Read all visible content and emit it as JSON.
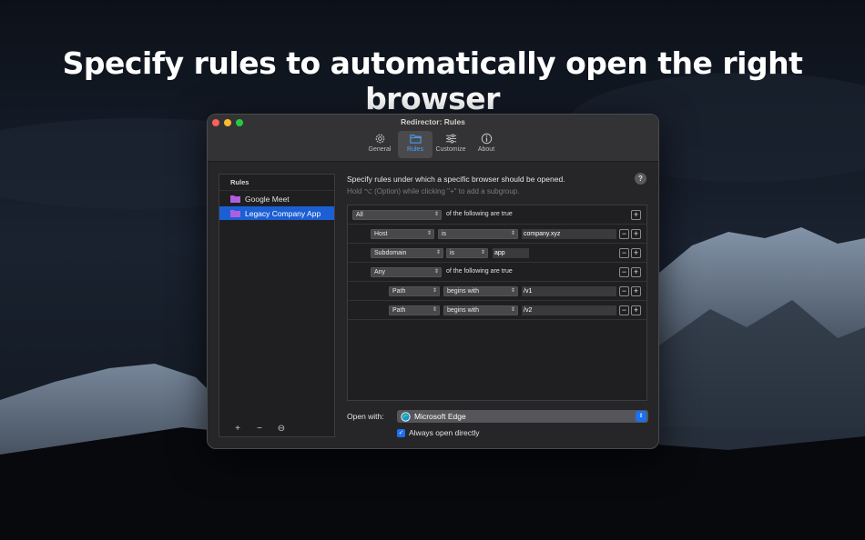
{
  "headline": "Specify rules to automatically open the right browser",
  "window": {
    "title": "Redirector: Rules"
  },
  "toolbar": {
    "tabs": [
      {
        "label": "General",
        "icon": "gear-icon",
        "selected": false
      },
      {
        "label": "Rules",
        "icon": "folder-icon",
        "selected": true
      },
      {
        "label": "Customize",
        "icon": "sliders-icon",
        "selected": false
      },
      {
        "label": "About",
        "icon": "info-icon",
        "selected": false
      }
    ]
  },
  "sidebar": {
    "header": "Rules",
    "items": [
      {
        "label": "Google Meet",
        "selected": false
      },
      {
        "label": "Legacy Company App",
        "selected": true
      }
    ],
    "footer": {
      "add": "+",
      "remove": "−",
      "more": "⊖"
    }
  },
  "main": {
    "description": "Specify rules under which a specific browser should be opened.",
    "hint": "Hold ⌥ (Option) while clicking \"+\" to add a subgroup.",
    "help": "?",
    "rules": [
      {
        "type": "group",
        "quantifier": "All",
        "suffix": "of the following are true"
      },
      {
        "type": "condition",
        "field": "Host",
        "operator": "is",
        "value": "company.xyz"
      },
      {
        "type": "condition",
        "field": "Subdomain",
        "operator": "is",
        "value": "app"
      },
      {
        "type": "group",
        "quantifier": "Any",
        "suffix": "of the following are true"
      },
      {
        "type": "condition",
        "field": "Path",
        "operator": "begins with",
        "value": "/v1"
      },
      {
        "type": "condition",
        "field": "Path",
        "operator": "begins with",
        "value": "/v2"
      }
    ],
    "open_with_label": "Open with:",
    "browser": "Microsoft Edge",
    "always_open_label": "Always open directly",
    "always_open_checked": true
  },
  "colors": {
    "accent": "#1c6ff0",
    "selection": "#1c5fd4",
    "close": "#fe5f57",
    "minimize": "#febc2e",
    "maximize": "#28c840"
  }
}
